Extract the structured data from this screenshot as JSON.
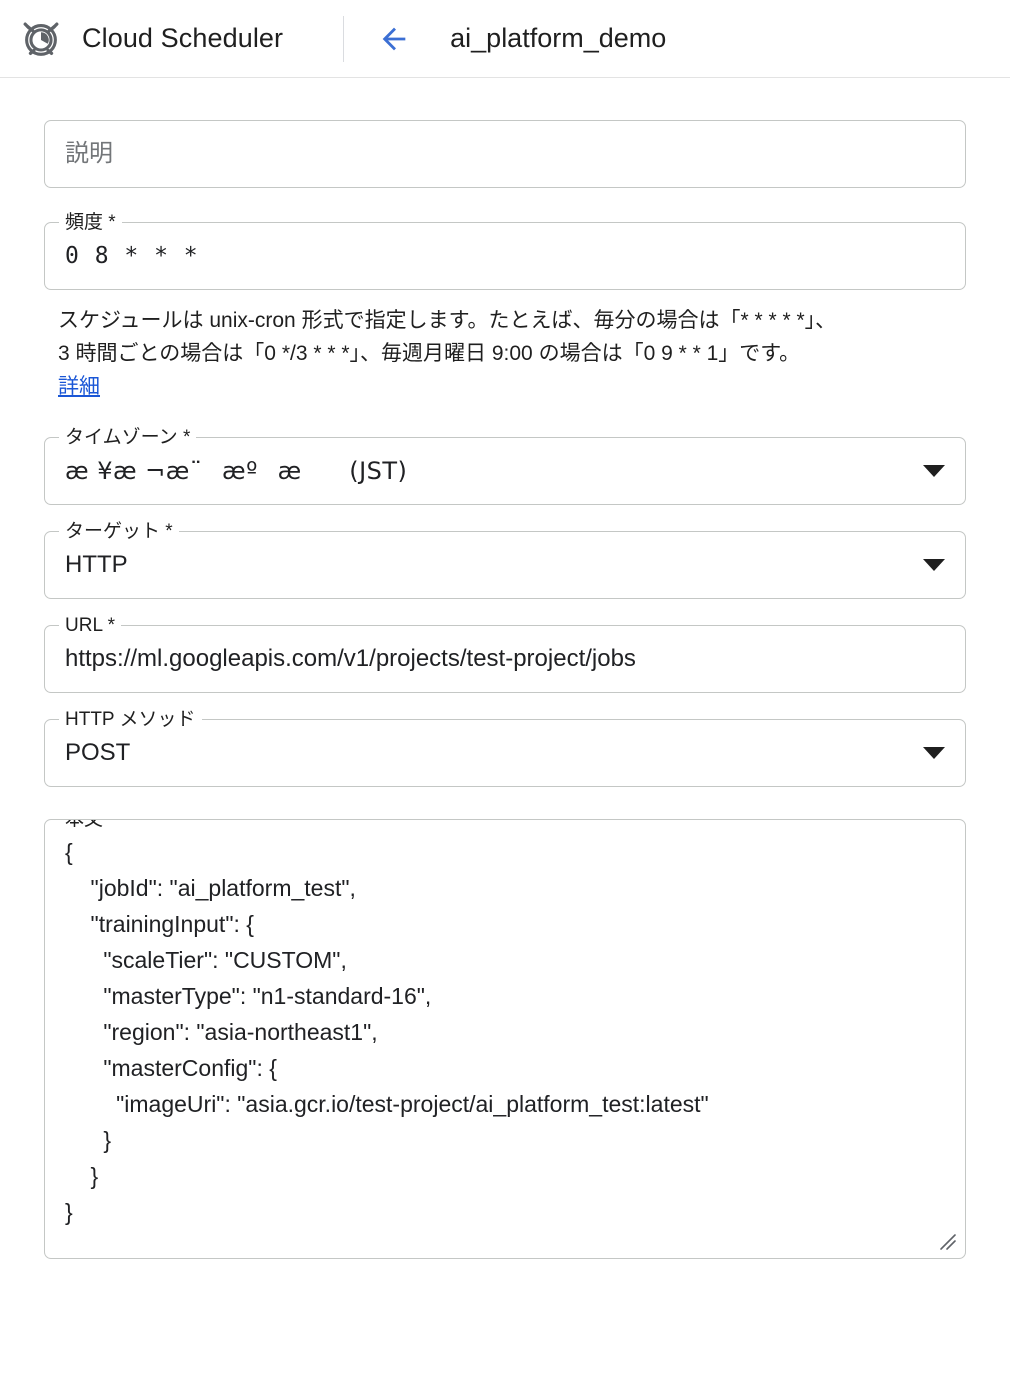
{
  "header": {
    "brand_icon": "alarm-clock-icon",
    "brand_title": "Cloud Scheduler",
    "back_icon": "arrow-left-icon",
    "job_title": "ai_platform_demo"
  },
  "form": {
    "description": {
      "placeholder": "説明",
      "value": ""
    },
    "frequency": {
      "label": "頻度 *",
      "value": "0 8 * * *",
      "helper_line1": "スケジュールは unix-cron 形式で指定します。たとえば、毎分の場合は「* * * * *」、",
      "helper_line2": "3 時間ごとの場合は「0 */3 * * *」、毎週月曜日 9:00 の場合は「0 9 * * 1」です。",
      "helper_link": "詳細"
    },
    "timezone": {
      "label": "タイムゾーン *",
      "value": "æ ¥æ ¬æ¨æºæ (JST)",
      "arrow_icon": "chevron-down-icon"
    },
    "target": {
      "label": "ターゲット *",
      "value": "HTTP",
      "arrow_icon": "chevron-down-icon"
    },
    "url": {
      "label": "URL *",
      "value": "https://ml.googleapis.com/v1/projects/test-project/jobs"
    },
    "http_method": {
      "label": "HTTP メソッド",
      "value": "POST",
      "arrow_icon": "chevron-down-icon"
    },
    "body": {
      "label": "本文",
      "value": "{\n    \"jobId\": \"ai_platform_test\",\n    \"trainingInput\": {\n      \"scaleTier\": \"CUSTOM\",\n      \"masterType\": \"n1-standard-16\",\n      \"region\": \"asia-northeast1\",\n      \"masterConfig\": {\n        \"imageUri\": \"asia.gcr.io/test-project/ai_platform_test:latest\"\n      }\n    }\n}",
      "resize_icon": "resize-handle-icon"
    }
  },
  "colors": {
    "accent_blue": "#1a56d6",
    "border_grey": "#c4c7c5",
    "text_primary": "#202124",
    "placeholder_grey": "#737679",
    "icon_grey": "#5f6368"
  }
}
